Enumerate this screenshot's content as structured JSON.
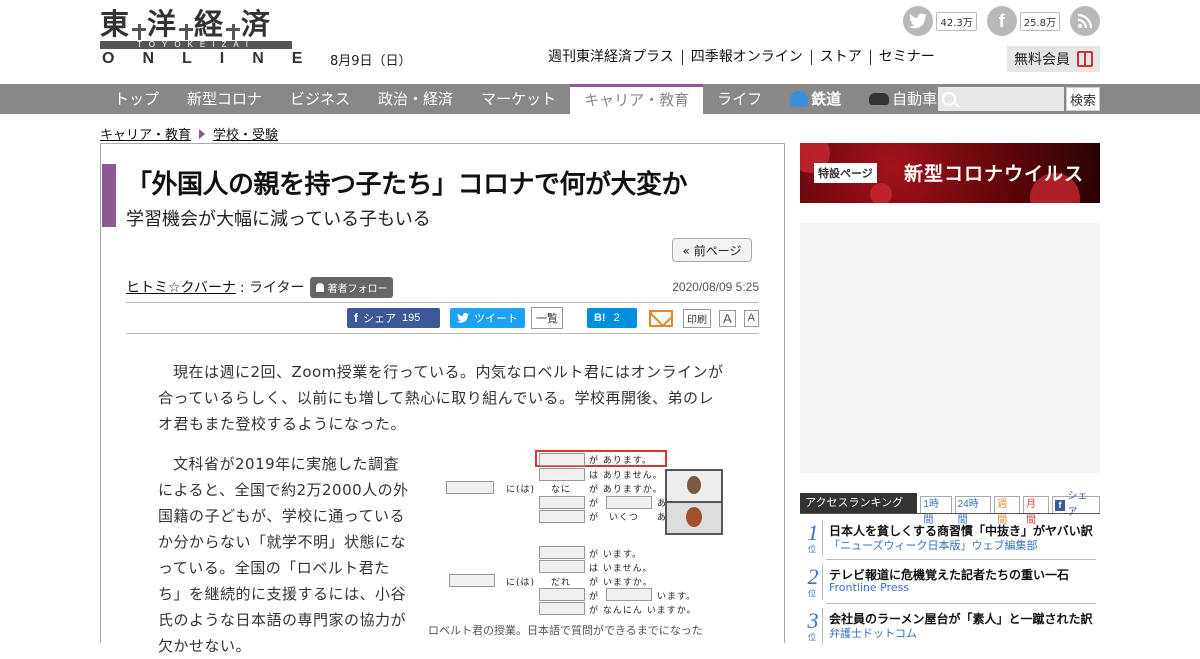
{
  "header": {
    "logo_top": [
      "東",
      "洋",
      "経",
      "済"
    ],
    "logo_bar": "TOYOKEIZAI",
    "logo_bottom": "ONLINE",
    "date": "8月9日（日）",
    "twitter_count": "42.3万",
    "facebook_count": "25.8万",
    "top_links": [
      "週刊東洋経済プラス",
      "四季報オンライン",
      "ストア",
      "セミナー"
    ],
    "member_label": "無料会員"
  },
  "nav": {
    "items": [
      "トップ",
      "新型コロナ",
      "ビジネス",
      "政治・経済",
      "マーケット",
      "キャリア・教育",
      "ライフ",
      "鉄道",
      "自動車"
    ],
    "active": "キャリア・教育",
    "search_placeholder": "",
    "search_button": "検索"
  },
  "breadcrumb": [
    "キャリア・教育",
    "学校・受験"
  ],
  "article": {
    "title": "「外国人の親を持つ子たち」コロナで何が大変か",
    "subtitle": "学習機会が大幅に減っている子もいる",
    "prev_page": "« 前ページ",
    "author": "ヒトミ☆クバーナ",
    "author_role": ": ライター",
    "follow_label": "著者フォロー",
    "pubdate": "2020/08/09 5:25",
    "share": {
      "fb_label": "シェア",
      "fb_count": "195",
      "tw_label": "ツイート",
      "list_label": "一覧",
      "hb_label": "B!",
      "hb_count": "2",
      "print_label": "印刷",
      "font_large": "A",
      "font_small": "A"
    },
    "paragraph1": "現在は週に2回、Zoom授業を行っている。内気なロベルト君にはオンラインが合っているらしく、以前にも増して熱心に取り組んでいる。学校再開後、弟のレオ君もまた登校するようになった。",
    "paragraph2": "文科省が2019年に実施した調査によると、全国で約2万2000人の外国籍の子どもが、学校に通っているか分からない「就学不明」状態になっている。全国の「ロベルト君たち」を継続的に支援するには、小谷氏のような日本語の専門家の協力が欠かせない。",
    "figure": {
      "rows_top": [
        "が あります。",
        "は ありません。",
        "が ありますか。",
        "が",
        "が　いくつ"
      ],
      "rows_bottom": [
        "が います。",
        "は いません。",
        "が いますか。",
        "が",
        "が なんにん いますか。"
      ],
      "end_top": [
        "あ",
        "あ"
      ],
      "end_bottom": [
        "います。"
      ],
      "left_top": [
        "に(は)",
        "なに"
      ],
      "left_bottom": [
        "に(は)",
        "だれ"
      ],
      "caption": "ロベルト君の授業。日本語で質問ができるまでになった"
    }
  },
  "sidebar": {
    "banner_tag": "特設ページ",
    "banner_title": "新型コロナウイルス",
    "ranking_title": "アクセスランキング",
    "ranking_tabs": [
      "1時間",
      "24時間",
      "週間",
      "月間",
      "シェア"
    ],
    "ranking_items": [
      {
        "num": "1",
        "unit": "位",
        "title": "日本人を貧しくする商習慣「中抜き」がヤバい訳",
        "source": "「ニューズウィーク日本版」ウェブ編集部"
      },
      {
        "num": "2",
        "unit": "位",
        "title": "テレビ報道に危機覚えた記者たちの重い一石",
        "source": "Frontline Press"
      },
      {
        "num": "3",
        "unit": "位",
        "title": "会社員のラーメン屋台が「素人」と一蹴された訳",
        "source": "弁護士ドットコム"
      }
    ]
  },
  "colors": {
    "accent": "#8e5a92",
    "nav_bg": "#888888",
    "link_blue": "#3a6fbf",
    "facebook": "#3b5998",
    "twitter": "#1da1f2",
    "hatena": "#008fde"
  }
}
